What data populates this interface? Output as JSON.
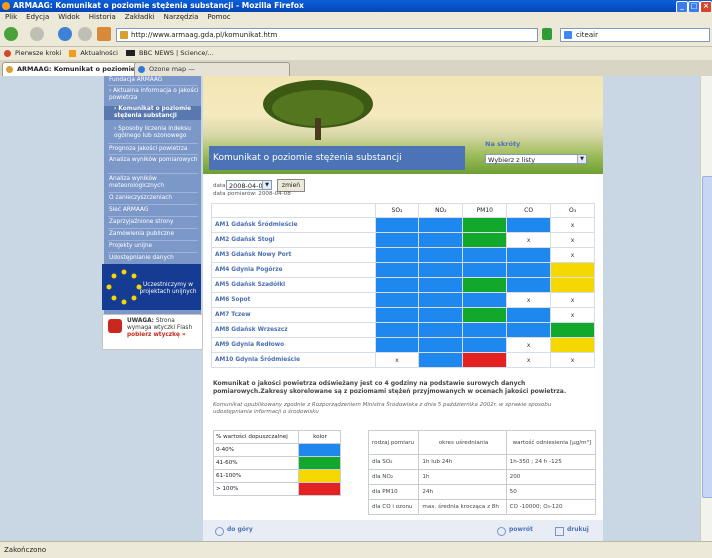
{
  "window": {
    "title": "ARMAAG: Komunikat o poziomie stężenia substancji - Mozilla Firefox"
  },
  "menu": [
    "Plik",
    "Edycja",
    "Widok",
    "Historia",
    "Zakładki",
    "Narzędzia",
    "Pomoc"
  ],
  "nav": {
    "url": "http://www.armaag.gda.pl/komunikat.htm",
    "search_value": "citeair"
  },
  "bookmarks": [
    "Pierwsze kroki",
    "Aktualności",
    "BBC NEWS | Science/..."
  ],
  "tabs": [
    {
      "label": "ARMAAG: Komunikat o poziomie ...",
      "active": true
    },
    {
      "label": "Ozone map —",
      "active": false
    }
  ],
  "sidebar": {
    "items": [
      {
        "label": "Fundacja ARMAAG"
      },
      {
        "label": "› Aktualna informacja o jakości powietrza"
      },
      {
        "label": "› Komunikat o poziomie stężenia substancji"
      },
      {
        "label": "› Sposoby liczenia indeksu ogólnego lub ozonowego"
      },
      {
        "label": "Prognoza jakości powietrza"
      },
      {
        "label": "Analiza wyników pomiarowych"
      },
      {
        "label": "Analiza wyników meteorologicznych"
      },
      {
        "label": "O zanieczyszczeniach"
      },
      {
        "label": "Sieć ARMAAG"
      },
      {
        "label": "Zaprzyjaźnione strony"
      },
      {
        "label": "Zamówienia publiczne"
      },
      {
        "label": "Projekty unijne"
      },
      {
        "label": "Udostępnianie danych"
      }
    ],
    "eu_text": "Uczestniczymy w projektach unijnych",
    "flash": {
      "bold": "UWAGA:",
      "text": "Strona wymaga wtyczki Flash",
      "link": "pobierz wtyczkę »"
    }
  },
  "main": {
    "title": "Komunikat o poziomie stężenia substancji",
    "shortcut_label": "Na skróty",
    "shortcut_select": "Wybierz z listy",
    "date_label": "data",
    "date_value": "2008-04-08",
    "date_button": "zmień",
    "measure_date": "data pomiarów: 2008-04-08",
    "columns": [
      "SO₂",
      "NO₂",
      "PM10",
      "CO",
      "O₃"
    ],
    "rows": [
      {
        "station": "AM1 Gdańsk Śródmieście",
        "cells": [
          "blue",
          "blue",
          "green",
          "blue",
          "x"
        ]
      },
      {
        "station": "AM2 Gdańsk Stogi",
        "cells": [
          "blue",
          "blue",
          "green",
          "x",
          "x"
        ]
      },
      {
        "station": "AM3 Gdańsk Nowy Port",
        "cells": [
          "blue",
          "blue",
          "blue",
          "blue",
          "x"
        ]
      },
      {
        "station": "AM4 Gdynia Pogórze",
        "cells": [
          "blue",
          "blue",
          "blue",
          "blue",
          "yellow"
        ]
      },
      {
        "station": "AM5 Gdańsk Szadółki",
        "cells": [
          "blue",
          "blue",
          "green",
          "blue",
          "yellow"
        ]
      },
      {
        "station": "AM6 Sopot",
        "cells": [
          "blue",
          "blue",
          "blue",
          "x",
          "x"
        ]
      },
      {
        "station": "AM7 Tczew",
        "cells": [
          "blue",
          "blue",
          "green",
          "blue",
          "x"
        ]
      },
      {
        "station": "AM8 Gdańsk Wrzeszcz",
        "cells": [
          "blue",
          "blue",
          "blue",
          "blue",
          "green"
        ]
      },
      {
        "station": "AM9 Gdynia Redłowo",
        "cells": [
          "blue",
          "blue",
          "blue",
          "x",
          "yellow"
        ]
      },
      {
        "station": "AM10 Gdynia Śródmieście",
        "cells": [
          "x",
          "blue",
          "red",
          "x",
          "x"
        ]
      }
    ],
    "x_mark": "x",
    "note_bold": "Komunikat o jakości powietrza odświeżany jest co 4 godziny na podstawie surowych danych pomiarowych.Zakresy skorelowane są z poziomami stężeń przyjmowanych w ocenach jakości powietrza.",
    "note_small": "Komunikat opublikowany zgodnie z Rozporządzeniem Ministra Środowiska z dnia 5 października 2002r. w sprawie sposobu udostępniania informacji o środowisku",
    "legend": {
      "header": [
        "% wartości dopuszczalnej",
        "kolor"
      ],
      "rows": [
        {
          "range": "0-40%",
          "color": "#1e88ee"
        },
        {
          "range": "41-60%",
          "color": "#12a82b"
        },
        {
          "range": "61-100%",
          "color": "#f4d800"
        },
        {
          "range": "> 100%",
          "color": "#e52222"
        }
      ]
    },
    "ref": {
      "header": [
        "rodzaj pomiaru",
        "okres uśredniania",
        "wartość odniesienia [µg/m³]"
      ],
      "rows": [
        [
          "dla SO₂",
          "1h lub 24h",
          "1h-350 ; 24 h -125"
        ],
        [
          "dla NO₂",
          "1h",
          "200"
        ],
        [
          "dla PM10",
          "24h",
          "50"
        ],
        [
          "dla CO i ozonu",
          "max. średnia krocząca z 8h",
          "CO -10000; O₃-120"
        ]
      ]
    },
    "footer": {
      "top": "do góry",
      "back": "powrót",
      "print": "drukuj"
    }
  },
  "status": "Zakończono"
}
